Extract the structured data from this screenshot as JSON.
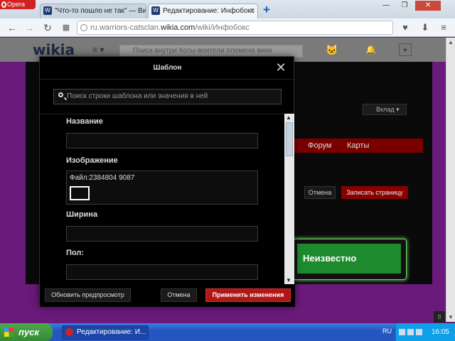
{
  "browser": {
    "menu_label": "Opera",
    "tabs": [
      {
        "title": "\"Что-то пошло не так\" — Ви",
        "favicon": "W"
      },
      {
        "title": "Редактирование: Инфобокс",
        "favicon": "W"
      }
    ],
    "new_tab_symbol": "+",
    "url": {
      "prefix": "ru.warriors-catsclan.",
      "domain": "wikia.com",
      "path": "/wiki/Инфобокс"
    }
  },
  "wikia": {
    "logo": "wikia",
    "search_placeholder": "Поиск внутри Коты-воители племена вики",
    "contribute_label": "Вклад",
    "nav_links": [
      "Форум",
      "Карты"
    ],
    "cancel_label": "Отмена",
    "save_label": "Записать страницу",
    "infobox_value": "Неизвестно"
  },
  "modal": {
    "title": "Шаблон",
    "search_placeholder": "Поиск строки шаблона или значения в ней",
    "fields": [
      {
        "label": "Название",
        "value": ""
      },
      {
        "label": "Изображение",
        "value": "Файл:2384804 9087"
      },
      {
        "label": "Ширина",
        "value": ""
      },
      {
        "label": "Пол:",
        "value": ""
      }
    ],
    "preview_label": "Обновить предпросмотр",
    "cancel_label": "Отмена",
    "apply_label": "Применить изменения"
  },
  "taskbar": {
    "start_label": "пуск",
    "task_title": "Редактирование: И...",
    "lang": "RU",
    "clock": "16:05"
  },
  "corner_badge": "8"
}
